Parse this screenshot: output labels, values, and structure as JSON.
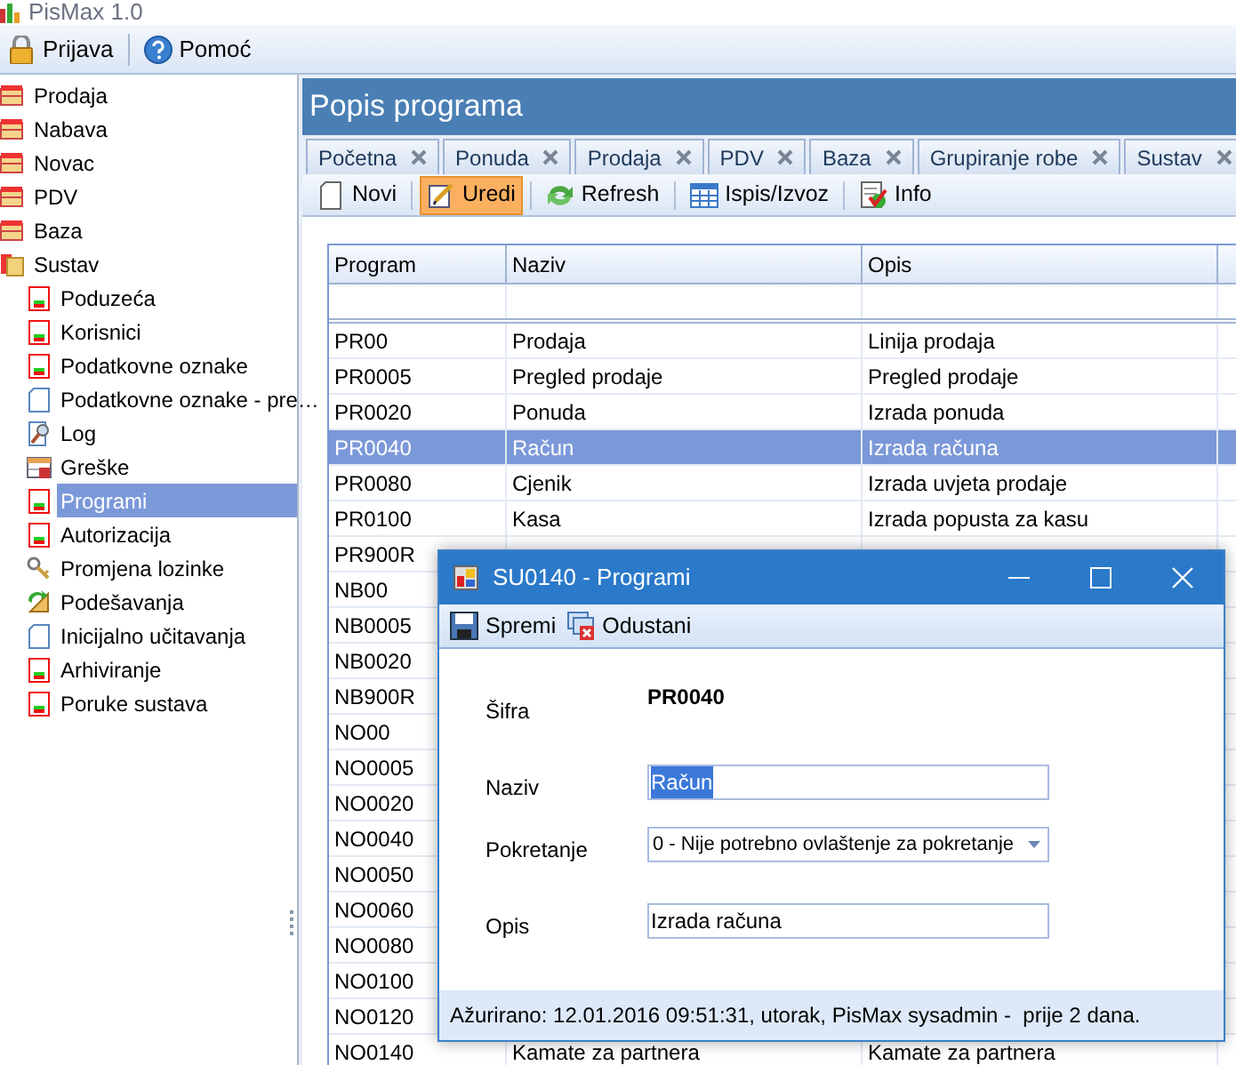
{
  "app": {
    "title": "PisMax 1.0"
  },
  "menu": [
    {
      "label": "Prijava",
      "kind": "lock"
    },
    {
      "label": "Pomoć",
      "kind": "help"
    }
  ],
  "sidebar": {
    "items": [
      {
        "label": "Prodaja",
        "kind": "module",
        "selected": false
      },
      {
        "label": "Nabava",
        "kind": "module",
        "selected": false
      },
      {
        "label": "Novac",
        "kind": "module",
        "selected": false
      },
      {
        "label": "PDV",
        "kind": "module",
        "selected": false
      },
      {
        "label": "Baza",
        "kind": "module",
        "selected": false
      },
      {
        "label": "Sustav",
        "kind": "folder",
        "selected": false,
        "children": [
          {
            "label": "Poduzeća",
            "kind": "form",
            "selected": false
          },
          {
            "label": "Korisnici",
            "kind": "form",
            "selected": false
          },
          {
            "label": "Podatkovne oznake",
            "kind": "form",
            "selected": false
          },
          {
            "label": "Podatkovne oznake - pre…",
            "kind": "blank",
            "selected": false
          },
          {
            "label": "Log",
            "kind": "log",
            "selected": false
          },
          {
            "label": "Greške",
            "kind": "grid",
            "selected": false
          },
          {
            "label": "Programi",
            "kind": "form",
            "selected": true
          },
          {
            "label": "Autorizacija",
            "kind": "form",
            "selected": false
          },
          {
            "label": "Promjena lozinke",
            "kind": "keys",
            "selected": false
          },
          {
            "label": "Podešavanja",
            "kind": "settings",
            "selected": false
          },
          {
            "label": "Inicijalno učitavanja",
            "kind": "blank",
            "selected": false
          },
          {
            "label": "Arhiviranje",
            "kind": "form",
            "selected": false
          },
          {
            "label": "Poruke sustava",
            "kind": "form",
            "selected": false
          }
        ]
      }
    ]
  },
  "panel": {
    "title": "Popis programa"
  },
  "tabs": [
    {
      "label": "Početna"
    },
    {
      "label": "Ponuda"
    },
    {
      "label": "Prodaja"
    },
    {
      "label": "PDV"
    },
    {
      "label": "Baza"
    },
    {
      "label": "Grupiranje robe"
    },
    {
      "label": "Sustav"
    }
  ],
  "toolbar": [
    {
      "label": "Novi",
      "kind": "new",
      "active": false
    },
    {
      "label": "Uredi",
      "kind": "edit",
      "active": true
    },
    {
      "label": "Refresh",
      "kind": "refresh",
      "active": false
    },
    {
      "label": "Ispis/Izvoz",
      "kind": "table",
      "active": false
    },
    {
      "label": "Info",
      "kind": "info",
      "active": false
    }
  ],
  "table": {
    "columns": [
      "Program",
      "Naziv",
      "Opis"
    ],
    "rows": [
      {
        "program": "PR00",
        "naziv": "Prodaja",
        "opis": "Linija prodaja",
        "selected": false
      },
      {
        "program": "PR0005",
        "naziv": "Pregled prodaje",
        "opis": "Pregled prodaje",
        "selected": false
      },
      {
        "program": "PR0020",
        "naziv": "Ponuda",
        "opis": "Izrada ponuda",
        "selected": false
      },
      {
        "program": "PR0040",
        "naziv": "Račun",
        "opis": "Izrada računa",
        "selected": true
      },
      {
        "program": "PR0080",
        "naziv": "Cjenik",
        "opis": "Izrada uvjeta prodaje",
        "selected": false
      },
      {
        "program": "PR0100",
        "naziv": "Kasa",
        "opis": "Izrada popusta za kasu",
        "selected": false
      },
      {
        "program": "PR900R",
        "selected": false
      },
      {
        "program": "NB00",
        "selected": false
      },
      {
        "program": "NB0005",
        "selected": false
      },
      {
        "program": "NB0020",
        "selected": false
      },
      {
        "program": "NB900R",
        "selected": false
      },
      {
        "program": "NO00",
        "selected": false
      },
      {
        "program": "NO0005",
        "selected": false
      },
      {
        "program": "NO0020",
        "selected": false
      },
      {
        "program": "NO0040",
        "selected": false
      },
      {
        "program": "NO0050",
        "selected": false
      },
      {
        "program": "NO0060",
        "selected": false
      },
      {
        "program": "NO0080",
        "selected": false
      },
      {
        "program": "NO0100",
        "selected": false
      },
      {
        "program": "NO0120",
        "selected": false
      },
      {
        "program": "NO0140",
        "naziv": "Kamate za partnera",
        "opis": "Kamate za partnera",
        "selected": false
      }
    ]
  },
  "dialog": {
    "title": "SU0140 - Programi",
    "toolbar": [
      {
        "label": "Spremi",
        "kind": "save"
      },
      {
        "label": "Odustani",
        "kind": "cancel"
      }
    ],
    "fields": [
      {
        "label": "Šifra",
        "kind": "static",
        "value": "PR0040"
      },
      {
        "label": "Naziv",
        "kind": "text",
        "value": "Račun",
        "text_selected": true
      },
      {
        "label": "Pokretanje",
        "kind": "dropdown",
        "value": "0 - Nije potrebno ovlaštenje za pokretanje"
      },
      {
        "label": "Opis",
        "kind": "text",
        "value": "Izrada računa",
        "text_selected": false
      }
    ],
    "status": "Ažurirano: 12.01.2016 09:51:31, utorak, PisMax sysadmin -  prije 2 dana."
  }
}
